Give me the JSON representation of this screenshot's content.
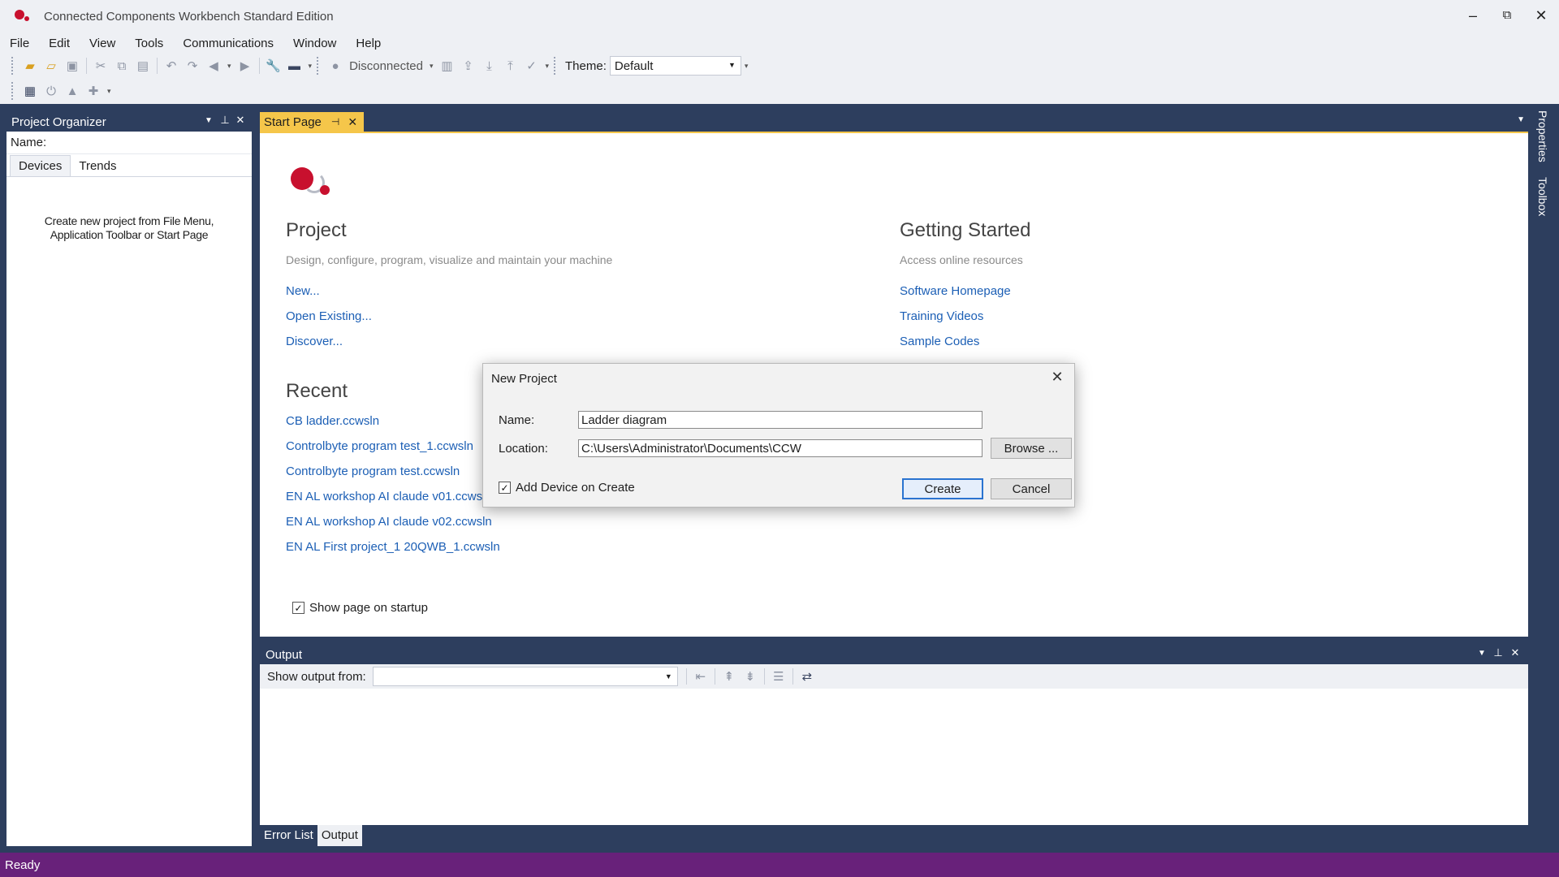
{
  "window": {
    "title": "Connected Components Workbench Standard Edition",
    "controls": {
      "minimize": "–",
      "restore": "⧉",
      "close": "✕"
    }
  },
  "menu": [
    "File",
    "Edit",
    "View",
    "Tools",
    "Communications",
    "Window",
    "Help"
  ],
  "toolbar": {
    "connection_status": "Disconnected",
    "theme_label": "Theme:",
    "theme_value": "Default"
  },
  "project_organizer": {
    "title": "Project Organizer",
    "name_label": "Name:",
    "tabs": [
      "Devices",
      "Trends"
    ],
    "hint_line1": "Create new project from File Menu,",
    "hint_line2": "Application Toolbar or Start Page"
  },
  "document_tabs": {
    "active": "Start Page"
  },
  "start_page": {
    "project": {
      "heading": "Project",
      "subtitle": "Design, configure, program, visualize and maintain your machine",
      "links": [
        "New...",
        "Open Existing...",
        "Discover..."
      ]
    },
    "getting_started": {
      "heading": "Getting Started",
      "subtitle": "Access online resources",
      "links": [
        "Software Homepage",
        "Training Videos",
        "Sample Codes"
      ]
    },
    "recent": {
      "heading": "Recent",
      "files": [
        "CB ladder.ccwsln",
        "Controlbyte program test_1.ccwsln",
        "Controlbyte program test.ccwsln",
        "EN AL workshop AI claude v01.ccwsln",
        "EN AL workshop AI claude v02.ccwsln",
        "EN AL First project_1 20QWB_1.ccwsln"
      ]
    },
    "show_on_startup": {
      "label": "Show page on startup",
      "checked": true
    }
  },
  "output": {
    "title": "Output",
    "source_label": "Show output from:",
    "source_value": ""
  },
  "bottom_tabs": [
    "Error List",
    "Output"
  ],
  "side_tabs": [
    "Properties",
    "Toolbox"
  ],
  "status": "Ready",
  "dialog": {
    "title": "New Project",
    "name_label": "Name:",
    "name_value": "Ladder diagram",
    "location_label": "Location:",
    "location_value": "C:\\Users\\Administrator\\Documents\\CCW",
    "browse_label": "Browse ...",
    "add_device_label": "Add Device on Create",
    "add_device_checked": true,
    "create_label": "Create",
    "cancel_label": "Cancel"
  },
  "colors": {
    "dark_panel": "#2d3e5e",
    "tab_accent": "#f5c64a",
    "link": "#1c5fb5",
    "status_bar": "#68217a",
    "brand_red": "#c8102e"
  }
}
